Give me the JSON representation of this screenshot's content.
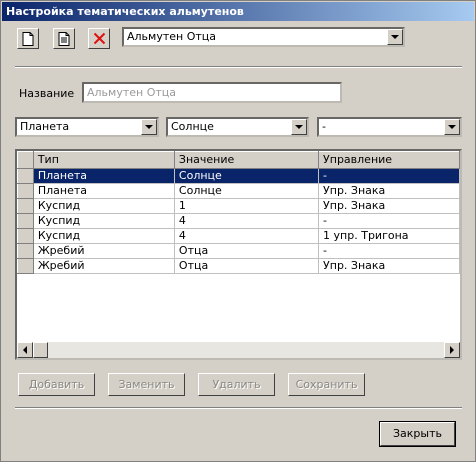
{
  "window": {
    "title": "Настройка тематических альмутенов"
  },
  "toolbar": {
    "new_icon": "new-document-icon",
    "copy_icon": "copy-document-icon",
    "delete_icon": "delete-x-icon",
    "delete_color": "#e01010",
    "almuten_select_value": "Альмутен Отца"
  },
  "form": {
    "name_label": "Название",
    "name_placeholder": "Альмутен Отца"
  },
  "filters": {
    "type_value": "Планета",
    "value_value": "Солнце",
    "control_value": "-"
  },
  "table": {
    "columns": [
      "Тип",
      "Значение",
      "Управление"
    ],
    "rows": [
      {
        "type": "Планета",
        "value": "Солнце",
        "control": "-",
        "selected": true
      },
      {
        "type": "Планета",
        "value": "Солнце",
        "control": "Упр. Знака",
        "selected": false
      },
      {
        "type": "Куспид",
        "value": "1",
        "control": "Упр. Знака",
        "selected": false
      },
      {
        "type": "Куспид",
        "value": "4",
        "control": "-",
        "selected": false
      },
      {
        "type": "Куспид",
        "value": "4",
        "control": "1 упр. Тригона",
        "selected": false
      },
      {
        "type": "Жребий",
        "value": "Отца",
        "control": "-",
        "selected": false
      },
      {
        "type": "Жребий",
        "value": "Отца",
        "control": "Упр. Знака",
        "selected": false
      }
    ],
    "selection_color": "#0a246a"
  },
  "actions": {
    "add_label": "Добавить",
    "replace_label": "Заменить",
    "delete_label": "Удалить",
    "save_label": "Сохранить",
    "close_label": "Закрыть"
  }
}
